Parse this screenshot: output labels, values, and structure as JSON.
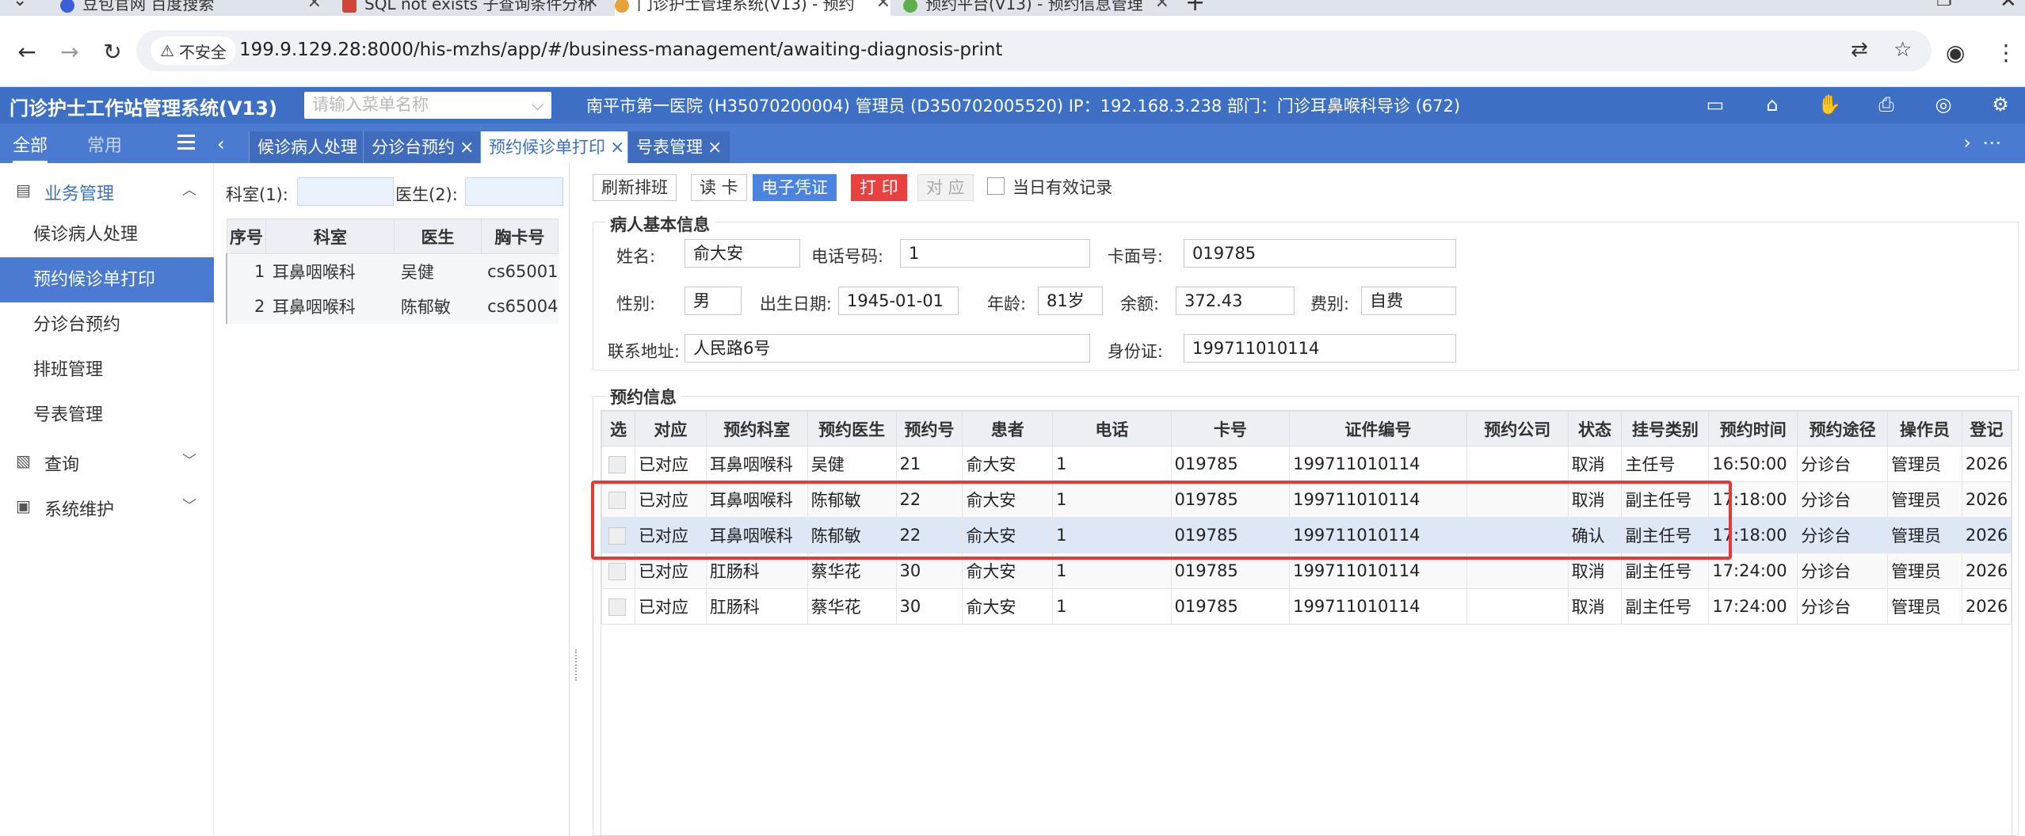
{
  "browser": {
    "tabs": [
      {
        "label": "豆包官网 百度搜索",
        "active": false
      },
      {
        "label": "SQL not exists 子查询条件分析",
        "active": false
      },
      {
        "label": "门诊护士管理系统(V13) - 预约",
        "active": true
      },
      {
        "label": "预约平台(V13) - 预约信息管理",
        "active": false
      }
    ],
    "new_tab_symbol": "+",
    "security_label": "不安全",
    "url": "199.9.129.28:8000/his-mzhs/app/#/business-management/awaiting-diagnosis-print"
  },
  "app": {
    "title": "门诊护士工作站管理系统(V13)",
    "menu_search_placeholder": "请输入菜单名称",
    "header_info": "南平市第一医院 (H35070200004) 管理员 (D350702005520) IP：192.168.3.238 部门：门诊耳鼻喉科导诊 (672)",
    "header_icons": [
      "monitor-icon",
      "presentation-icon",
      "hand-icon",
      "printer-icon",
      "eye-icon",
      "gear-icon"
    ]
  },
  "side_tabs": {
    "all": "全部",
    "common": "常用"
  },
  "page_tabs": [
    {
      "label": "候诊病人处理",
      "closable": false,
      "active": false
    },
    {
      "label": "分诊台预约",
      "closable": true,
      "active": false
    },
    {
      "label": "预约候诊单打印",
      "closable": true,
      "active": true
    },
    {
      "label": "号表管理",
      "closable": true,
      "active": false
    }
  ],
  "sidebar": {
    "groups": [
      {
        "label": "业务管理",
        "expanded": true,
        "items": [
          "候诊病人处理",
          "预约候诊单打印",
          "分诊台预约",
          "排班管理",
          "号表管理"
        ],
        "active_item": "预约候诊单打印"
      },
      {
        "label": "查询",
        "expanded": false
      },
      {
        "label": "系统维护",
        "expanded": false
      }
    ]
  },
  "list_panel": {
    "dept_label": "科室(1):",
    "doctor_label": "医生(2):",
    "columns": [
      "序号",
      "科室",
      "医生",
      "胸卡号"
    ],
    "rows": [
      [
        "1",
        "耳鼻咽喉科",
        "吴健",
        "cs65001"
      ],
      [
        "2",
        "耳鼻咽喉科",
        "陈郁敏",
        "cs65004"
      ]
    ]
  },
  "toolbar": {
    "refresh": "刷新排班",
    "read_card": "读 卡",
    "e_voucher": "电子凭证",
    "print": "打 印",
    "match": "对 应",
    "today_only": "当日有效记录"
  },
  "patient": {
    "section_title": "病人基本信息",
    "name_label": "姓名:",
    "name": "俞大安",
    "phone_label": "电话号码:",
    "phone": "1",
    "card_label": "卡面号:",
    "card": "019785",
    "sex_label": "性别:",
    "sex": "男",
    "dob_label": "出生日期:",
    "dob": "1945-01-01",
    "age_label": "年龄:",
    "age": "81岁",
    "balance_label": "余额:",
    "balance": "372.43",
    "fee_label": "费别:",
    "fee": "自费",
    "address_label": "联系地址:",
    "address": "人民路6号",
    "id_label": "身份证:",
    "id_no": "199711010114"
  },
  "appointments": {
    "section_title": "预约信息",
    "columns": [
      "选",
      "对应",
      "预约科室",
      "预约医生",
      "预约号",
      "患者",
      "电话",
      "卡号",
      "证件编号",
      "预约公司",
      "状态",
      "挂号类别",
      "预约时间",
      "预约途径",
      "操作员",
      "登记"
    ],
    "rows": [
      [
        "",
        "已对应",
        "耳鼻咽喉科",
        "吴健",
        "21",
        "俞大安",
        "1",
        "019785",
        "199711010114",
        "",
        "取消",
        "主任号",
        "16:50:00",
        "分诊台",
        "管理员",
        "2026"
      ],
      [
        "",
        "已对应",
        "耳鼻咽喉科",
        "陈郁敏",
        "22",
        "俞大安",
        "1",
        "019785",
        "199711010114",
        "",
        "取消",
        "副主任号",
        "17:18:00",
        "分诊台",
        "管理员",
        "2026"
      ],
      [
        "",
        "已对应",
        "耳鼻咽喉科",
        "陈郁敏",
        "22",
        "俞大安",
        "1",
        "019785",
        "199711010114",
        "",
        "确认",
        "副主任号",
        "17:18:00",
        "分诊台",
        "管理员",
        "2026"
      ],
      [
        "",
        "已对应",
        "肛肠科",
        "蔡华花",
        "30",
        "俞大安",
        "1",
        "019785",
        "199711010114",
        "",
        "取消",
        "副主任号",
        "17:24:00",
        "分诊台",
        "管理员",
        "2026"
      ],
      [
        "",
        "已对应",
        "肛肠科",
        "蔡华花",
        "30",
        "俞大安",
        "1",
        "019785",
        "199711010114",
        "",
        "取消",
        "副主任号",
        "17:24:00",
        "分诊台",
        "管理员",
        "2026"
      ]
    ],
    "selected_row": 2,
    "highlight_color": "#e53935"
  },
  "colors": {
    "primary": "#3d6fc4",
    "tab_bar": "#4a7bd0",
    "print_button": "#e94040",
    "evoucher_button": "#4a84e0"
  }
}
